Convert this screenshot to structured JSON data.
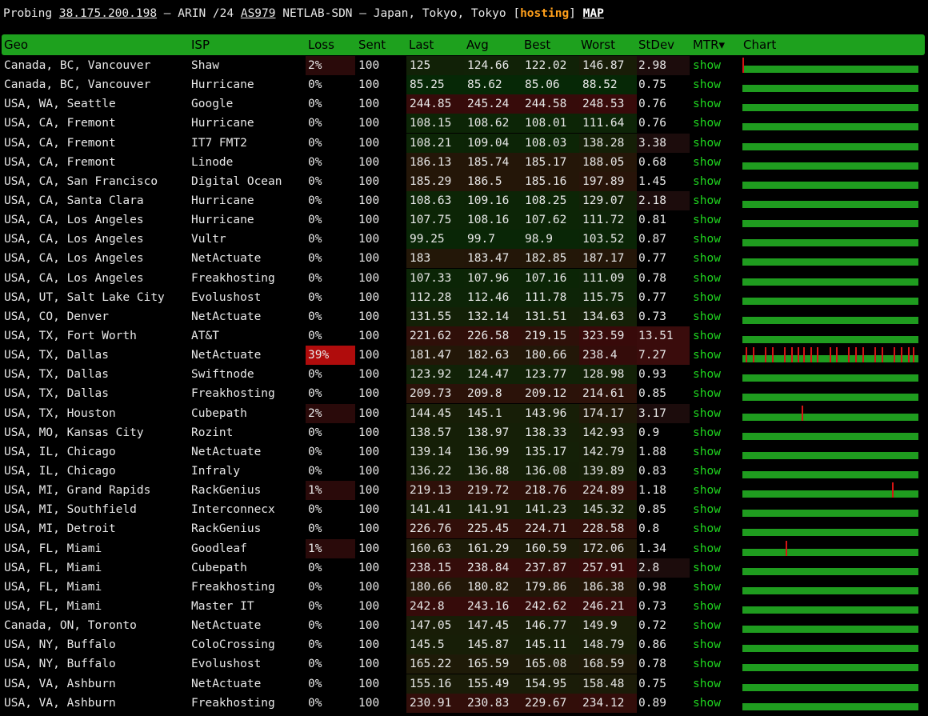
{
  "header": {
    "probing": "Probing",
    "ip": "38.175.200.198",
    "dash1": "—",
    "registry": "ARIN /24",
    "asn": "AS979",
    "network": "NETLAB-SDN — Japan, Tokyo, Tokyo",
    "hosting": "hosting",
    "map": "MAP"
  },
  "columns": {
    "geo": "Geo",
    "isp": "ISP",
    "loss": "Loss",
    "sent": "Sent",
    "last": "Last",
    "avg": "Avg",
    "best": "Best",
    "worst": "Worst",
    "stdev": "StDev",
    "mtr": "MTR▾",
    "chart": "Chart"
  },
  "colors": {
    "header_green": "#1ea11e",
    "link_green": "#1fd51f",
    "bar_green": "#1f9c1f",
    "loss_red": "#d81414",
    "hosting_orange": "#ff9f1a"
  },
  "rows": [
    {
      "geo": "Canada, BC, Vancouver",
      "isp": "Shaw",
      "loss": "2%",
      "sent": "100",
      "last": "125",
      "avg": "124.66",
      "best": "122.02",
      "worst": "146.87",
      "stdev": "2.98",
      "mtr": "show"
    },
    {
      "geo": "Canada, BC, Vancouver",
      "isp": "Hurricane",
      "loss": "0%",
      "sent": "100",
      "last": "85.25",
      "avg": "85.62",
      "best": "85.06",
      "worst": "88.52",
      "stdev": "0.75",
      "mtr": "show"
    },
    {
      "geo": "USA, WA, Seattle",
      "isp": "Google",
      "loss": "0%",
      "sent": "100",
      "last": "244.85",
      "avg": "245.24",
      "best": "244.58",
      "worst": "248.53",
      "stdev": "0.76",
      "mtr": "show"
    },
    {
      "geo": "USA, CA, Fremont",
      "isp": "Hurricane",
      "loss": "0%",
      "sent": "100",
      "last": "108.15",
      "avg": "108.62",
      "best": "108.01",
      "worst": "111.64",
      "stdev": "0.76",
      "mtr": "show"
    },
    {
      "geo": "USA, CA, Fremont",
      "isp": "IT7 FMT2",
      "loss": "0%",
      "sent": "100",
      "last": "108.21",
      "avg": "109.04",
      "best": "108.03",
      "worst": "138.28",
      "stdev": "3.38",
      "mtr": "show"
    },
    {
      "geo": "USA, CA, Fremont",
      "isp": "Linode",
      "loss": "0%",
      "sent": "100",
      "last": "186.13",
      "avg": "185.74",
      "best": "185.17",
      "worst": "188.05",
      "stdev": "0.68",
      "mtr": "show"
    },
    {
      "geo": "USA, CA, San Francisco",
      "isp": "Digital Ocean",
      "loss": "0%",
      "sent": "100",
      "last": "185.29",
      "avg": "186.5",
      "best": "185.16",
      "worst": "197.89",
      "stdev": "1.45",
      "mtr": "show"
    },
    {
      "geo": "USA, CA, Santa Clara",
      "isp": "Hurricane",
      "loss": "0%",
      "sent": "100",
      "last": "108.63",
      "avg": "109.16",
      "best": "108.25",
      "worst": "129.07",
      "stdev": "2.18",
      "mtr": "show"
    },
    {
      "geo": "USA, CA, Los Angeles",
      "isp": "Hurricane",
      "loss": "0%",
      "sent": "100",
      "last": "107.75",
      "avg": "108.16",
      "best": "107.62",
      "worst": "111.72",
      "stdev": "0.81",
      "mtr": "show"
    },
    {
      "geo": "USA, CA, Los Angeles",
      "isp": "Vultr",
      "loss": "0%",
      "sent": "100",
      "last": "99.25",
      "avg": "99.7",
      "best": "98.9",
      "worst": "103.52",
      "stdev": "0.87",
      "mtr": "show"
    },
    {
      "geo": "USA, CA, Los Angeles",
      "isp": "NetActuate",
      "loss": "0%",
      "sent": "100",
      "last": "183",
      "avg": "183.47",
      "best": "182.85",
      "worst": "187.17",
      "stdev": "0.77",
      "mtr": "show"
    },
    {
      "geo": "USA, CA, Los Angeles",
      "isp": "Freakhosting",
      "loss": "0%",
      "sent": "100",
      "last": "107.33",
      "avg": "107.96",
      "best": "107.16",
      "worst": "111.09",
      "stdev": "0.78",
      "mtr": "show"
    },
    {
      "geo": "USA, UT, Salt Lake City",
      "isp": "Evolushost",
      "loss": "0%",
      "sent": "100",
      "last": "112.28",
      "avg": "112.46",
      "best": "111.78",
      "worst": "115.75",
      "stdev": "0.77",
      "mtr": "show"
    },
    {
      "geo": "USA, CO, Denver",
      "isp": "NetActuate",
      "loss": "0%",
      "sent": "100",
      "last": "131.55",
      "avg": "132.14",
      "best": "131.51",
      "worst": "134.63",
      "stdev": "0.73",
      "mtr": "show"
    },
    {
      "geo": "USA, TX, Fort Worth",
      "isp": "AT&T",
      "loss": "0%",
      "sent": "100",
      "last": "221.62",
      "avg": "226.58",
      "best": "219.15",
      "worst": "323.59",
      "stdev": "13.51",
      "mtr": "show"
    },
    {
      "geo": "USA, TX, Dallas",
      "isp": "NetActuate",
      "loss": "39%",
      "sent": "100",
      "last": "181.47",
      "avg": "182.63",
      "best": "180.66",
      "worst": "238.4",
      "stdev": "7.27",
      "mtr": "show"
    },
    {
      "geo": "USA, TX, Dallas",
      "isp": "Swiftnode",
      "loss": "0%",
      "sent": "100",
      "last": "123.92",
      "avg": "124.47",
      "best": "123.77",
      "worst": "128.98",
      "stdev": "0.93",
      "mtr": "show"
    },
    {
      "geo": "USA, TX, Dallas",
      "isp": "Freakhosting",
      "loss": "0%",
      "sent": "100",
      "last": "209.73",
      "avg": "209.8",
      "best": "209.12",
      "worst": "214.61",
      "stdev": "0.85",
      "mtr": "show"
    },
    {
      "geo": "USA, TX, Houston",
      "isp": "Cubepath",
      "loss": "2%",
      "sent": "100",
      "last": "144.45",
      "avg": "145.1",
      "best": "143.96",
      "worst": "174.17",
      "stdev": "3.17",
      "mtr": "show"
    },
    {
      "geo": "USA, MO, Kansas City",
      "isp": "Rozint",
      "loss": "0%",
      "sent": "100",
      "last": "138.57",
      "avg": "138.97",
      "best": "138.33",
      "worst": "142.93",
      "stdev": "0.9",
      "mtr": "show"
    },
    {
      "geo": "USA, IL, Chicago",
      "isp": "NetActuate",
      "loss": "0%",
      "sent": "100",
      "last": "139.14",
      "avg": "136.99",
      "best": "135.17",
      "worst": "142.79",
      "stdev": "1.88",
      "mtr": "show"
    },
    {
      "geo": "USA, IL, Chicago",
      "isp": "Infraly",
      "loss": "0%",
      "sent": "100",
      "last": "136.22",
      "avg": "136.88",
      "best": "136.08",
      "worst": "139.89",
      "stdev": "0.83",
      "mtr": "show"
    },
    {
      "geo": "USA, MI, Grand Rapids",
      "isp": "RackGenius",
      "loss": "1%",
      "sent": "100",
      "last": "219.13",
      "avg": "219.72",
      "best": "218.76",
      "worst": "224.89",
      "stdev": "1.18",
      "mtr": "show"
    },
    {
      "geo": "USA, MI, Southfield",
      "isp": "Interconnecx",
      "loss": "0%",
      "sent": "100",
      "last": "141.41",
      "avg": "141.91",
      "best": "141.23",
      "worst": "145.32",
      "stdev": "0.85",
      "mtr": "show"
    },
    {
      "geo": "USA, MI, Detroit",
      "isp": "RackGenius",
      "loss": "0%",
      "sent": "100",
      "last": "226.76",
      "avg": "225.45",
      "best": "224.71",
      "worst": "228.58",
      "stdev": "0.8",
      "mtr": "show"
    },
    {
      "geo": "USA, FL, Miami",
      "isp": "Goodleaf",
      "loss": "1%",
      "sent": "100",
      "last": "160.63",
      "avg": "161.29",
      "best": "160.59",
      "worst": "172.06",
      "stdev": "1.34",
      "mtr": "show"
    },
    {
      "geo": "USA, FL, Miami",
      "isp": "Cubepath",
      "loss": "0%",
      "sent": "100",
      "last": "238.15",
      "avg": "238.84",
      "best": "237.87",
      "worst": "257.91",
      "stdev": "2.8",
      "mtr": "show"
    },
    {
      "geo": "USA, FL, Miami",
      "isp": "Freakhosting",
      "loss": "0%",
      "sent": "100",
      "last": "180.66",
      "avg": "180.82",
      "best": "179.86",
      "worst": "186.38",
      "stdev": "0.98",
      "mtr": "show"
    },
    {
      "geo": "USA, FL, Miami",
      "isp": "Master IT",
      "loss": "0%",
      "sent": "100",
      "last": "242.8",
      "avg": "243.16",
      "best": "242.62",
      "worst": "246.21",
      "stdev": "0.73",
      "mtr": "show"
    },
    {
      "geo": "Canada, ON, Toronto",
      "isp": "NetActuate",
      "loss": "0%",
      "sent": "100",
      "last": "147.05",
      "avg": "147.45",
      "best": "146.77",
      "worst": "149.9",
      "stdev": "0.72",
      "mtr": "show"
    },
    {
      "geo": "USA, NY, Buffalo",
      "isp": "ColoCrossing",
      "loss": "0%",
      "sent": "100",
      "last": "145.5",
      "avg": "145.87",
      "best": "145.11",
      "worst": "148.79",
      "stdev": "0.86",
      "mtr": "show"
    },
    {
      "geo": "USA, NY, Buffalo",
      "isp": "Evolushost",
      "loss": "0%",
      "sent": "100",
      "last": "165.22",
      "avg": "165.59",
      "best": "165.08",
      "worst": "168.59",
      "stdev": "0.78",
      "mtr": "show"
    },
    {
      "geo": "USA, VA, Ashburn",
      "isp": "NetActuate",
      "loss": "0%",
      "sent": "100",
      "last": "155.16",
      "avg": "155.49",
      "best": "154.95",
      "worst": "158.48",
      "stdev": "0.75",
      "mtr": "show"
    },
    {
      "geo": "USA, VA, Ashburn",
      "isp": "Freakhosting",
      "loss": "0%",
      "sent": "100",
      "last": "230.91",
      "avg": "230.83",
      "best": "229.67",
      "worst": "234.12",
      "stdev": "0.89",
      "mtr": "show"
    }
  ]
}
